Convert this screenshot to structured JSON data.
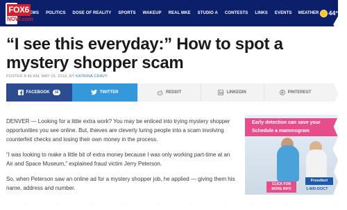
{
  "nav": {
    "logo_top": "FOX6",
    "logo_bottom": "NOW.com",
    "items": [
      "NEWS",
      "POLITICS",
      "DOSE OF REALITY",
      "SPORTS",
      "WAKEUP",
      "REAL MKE",
      "STUDIO A",
      "CONTESTS",
      "LINKS",
      "EVENTS"
    ],
    "weather_label": "WEATHER",
    "weather_temp": "44°",
    "weather_icon": "sun-icon"
  },
  "headline": "“I see this everyday:” How to spot a mystery shopper scam",
  "byline": {
    "prefix": "POSTED 8:45 AM, MAY 15, 2016, BY ",
    "author": "KATRINA CRAVY"
  },
  "share": {
    "facebook_label": "FACEBOOK",
    "facebook_count": "18",
    "twitter_label": "TWITTER",
    "reddit_label": "REDDIT",
    "linkedin_label": "LINKEDIN",
    "pinterest_label": "PINTEREST",
    "icons": [
      "facebook-icon",
      "twitter-icon",
      "reddit-icon",
      "linkedin-icon",
      "pinterest-icon"
    ]
  },
  "article": {
    "paragraphs": [
      "DENVER — Looking for a little extra work? You may be enticed into trying mystery shopper opportunities you see online. But, thieves are cleverly luring people into a scam involving counterfeit checks and losing their own money in the process.",
      "“I was looking to make a little bit of extra money because I was only working part-time at an Air and Space Museum,” explained fraud victim Jerry Peterson.",
      "So, when Peterson saw an online ad for a mystery shopper job, he applied — giving them his name, address and number."
    ]
  },
  "ad": {
    "line1": "Early detection can save your",
    "line2": "Schedule a mammogram",
    "cta": "CLICK FOR MORE INFO",
    "brand": "Froedtert",
    "phone": "1-800-DOCT"
  },
  "colors": {
    "nav_bg": "#0b1f6b",
    "brand_red": "#d3202f",
    "facebook": "#2b4d8f",
    "twitter": "#3498db",
    "ad_pink": "#e64d8a"
  }
}
